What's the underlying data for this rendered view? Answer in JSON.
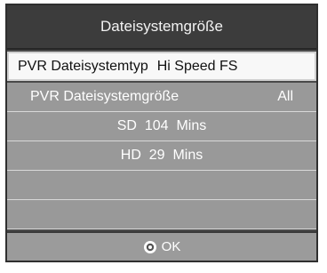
{
  "dialog": {
    "title": "Dateisystemgröße"
  },
  "rows": {
    "type": {
      "label": "PVR Dateisystemtyp",
      "value": "Hi Speed FS"
    },
    "size": {
      "label": "PVR Dateisystemgröße",
      "value": "All"
    },
    "sd": {
      "format": "SD",
      "amount": "104",
      "unit": "Mins"
    },
    "hd": {
      "format": "HD",
      "amount": "29",
      "unit": "Mins"
    }
  },
  "footer": {
    "ok_label": "OK",
    "ok_icon": "ok-circle-icon"
  },
  "colors": {
    "title_bg": "#3c3c3c",
    "row_bg": "#999999",
    "highlight_bg": "#f8f8f8"
  }
}
